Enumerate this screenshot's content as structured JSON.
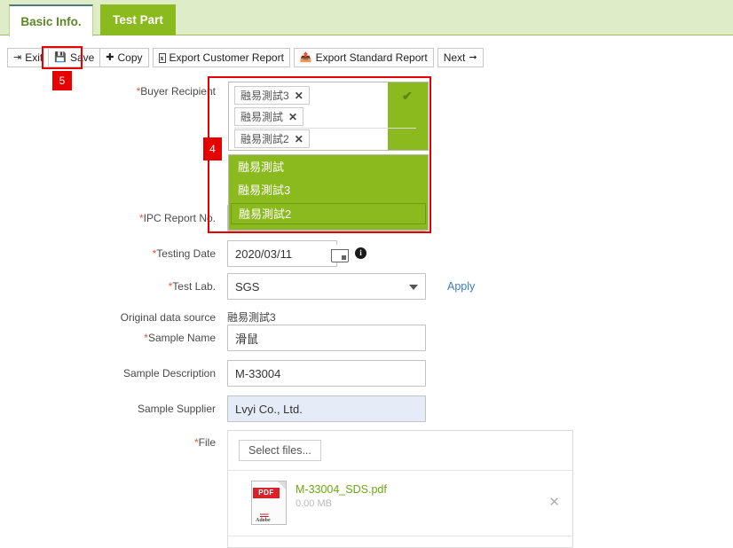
{
  "tabs": [
    {
      "label": "Basic Info.",
      "active": true
    },
    {
      "label": "Test Part",
      "active": false
    }
  ],
  "toolbar": {
    "exit_label": "Exit",
    "save_label": "Save",
    "copy_label": "Copy",
    "export_customer_label": "Export Customer Report",
    "export_standard_label": "Export Standard Report",
    "next_label": "Next"
  },
  "markers": {
    "save_marker": "5",
    "buyer_marker": "4"
  },
  "form": {
    "buyer_recipient": {
      "label": "Buyer Recipient",
      "required": true,
      "chips": [
        {
          "text": "融易測試3",
          "remove": "✕"
        },
        {
          "text": "融易測試",
          "remove": "✕"
        },
        {
          "text": "融易測試2",
          "remove": "✕"
        }
      ],
      "confirm_icon": "✔",
      "options": [
        {
          "text": "融易測試",
          "selected": false
        },
        {
          "text": "融易測試3",
          "selected": false
        },
        {
          "text": "融易測試2",
          "selected": true
        }
      ]
    },
    "ipc_report_no": {
      "label": "IPC Report No.",
      "required": true,
      "value": ""
    },
    "testing_date": {
      "label": "Testing Date",
      "required": true,
      "value": "2020/03/11",
      "calendar_icon": "calendar-icon",
      "info_icon": "i"
    },
    "test_lab": {
      "label": "Test Lab.",
      "required": true,
      "value": "SGS",
      "apply_label": "Apply"
    },
    "original_data_source": {
      "label": "Original data source",
      "required": false,
      "value": "融易測試3"
    },
    "sample_name": {
      "label": "Sample Name",
      "required": true,
      "value": "滑鼠"
    },
    "sample_description": {
      "label": "Sample Description",
      "required": false,
      "value": "M-33004"
    },
    "sample_supplier": {
      "label": "Sample Supplier",
      "required": false,
      "value": "Lvyi Co., Ltd."
    },
    "file": {
      "label": "File",
      "required": true,
      "select_files_label": "Select files...",
      "items": [
        {
          "name": "M-33004_SDS.pdf",
          "size": "0.00 MB",
          "type_label": "PDF",
          "brand_label": "Adobe",
          "remove": "✕"
        }
      ]
    }
  },
  "colors": {
    "brand_green": "#8bba1f",
    "tab_bg": "#dfecc8",
    "marker_red": "#e60000",
    "link_blue": "#3c7dbf",
    "required_red": "#e8553c",
    "file_link_green": "#6aa80f"
  }
}
